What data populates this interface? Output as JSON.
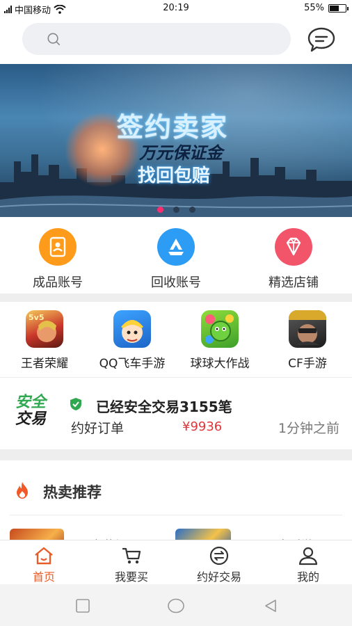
{
  "status_bar": {
    "carrier": "中国移动",
    "time": "20:19",
    "battery": "55%",
    "battery_level": 0.55
  },
  "header": {
    "search_icon": "search-icon",
    "message_icon": "chat-bubble-icon"
  },
  "banner": {
    "title": "签约卖家",
    "subtitle1": "万元保证金",
    "subtitle2": "找回包赔",
    "slides": 3,
    "active_slide": 1
  },
  "categories": [
    {
      "label": "成品账号",
      "icon": "account-card-icon",
      "color": "#ff9b1a"
    },
    {
      "label": "回收账号",
      "icon": "recycle-drive-icon",
      "color": "#2c9cf5"
    },
    {
      "label": "精选店铺",
      "icon": "diamond-icon",
      "color": "#f2546a"
    }
  ],
  "games": [
    {
      "label": "王者荣耀",
      "icon": "honor-of-kings-icon"
    },
    {
      "label": "QQ飞车手游",
      "icon": "qq-speed-icon"
    },
    {
      "label": "球球大作战",
      "icon": "ball-battle-icon"
    },
    {
      "label": "CF手游",
      "icon": "cf-mobile-icon"
    }
  ],
  "safe_trade": {
    "logo_line1": "安全",
    "logo_line2": "交易",
    "count_text": "已经安全交易3155笔",
    "order_label": "约好订单",
    "price": "¥9936",
    "time_ago": "1分钟之前",
    "accent": "#e0353b"
  },
  "hot": {
    "title": "热卖推荐",
    "items": [
      {
        "label": "王者荣耀"
      },
      {
        "label": "QQ飞车手游"
      }
    ]
  },
  "tabbar": {
    "accent": "#e85c2a",
    "tabs": [
      {
        "label": "首页",
        "icon": "home-icon",
        "active": true
      },
      {
        "label": "我要买",
        "icon": "cart-icon",
        "active": false
      },
      {
        "label": "约好交易",
        "icon": "exchange-icon",
        "active": false
      },
      {
        "label": "我的",
        "icon": "user-icon",
        "active": false
      }
    ]
  },
  "system_nav": {
    "items": [
      "square-recents-icon",
      "circle-home-icon",
      "triangle-back-icon"
    ]
  }
}
